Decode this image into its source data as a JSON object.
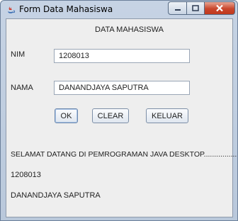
{
  "window": {
    "title": "Form Data Mahasiswa",
    "minimize_label": "minimize",
    "maximize_label": "maximize",
    "close_label": "close"
  },
  "form": {
    "heading": "DATA MAHASISWA",
    "nim_label": "NIM",
    "nim_value": "1208013",
    "nama_label": "NAMA",
    "nama_value": "DANANDJAYA SAPUTRA"
  },
  "buttons": {
    "ok": "OK",
    "clear": "CLEAR",
    "keluar": "KELUAR"
  },
  "output": {
    "welcome": "SELAMAT DATANG DI PEMROGRAMAN JAVA DESKTOP................",
    "nim": "1208013",
    "nama": "DANANDJAYA SAPUTRA"
  },
  "colors": {
    "titlebar": "#c6d3e4",
    "client_bg": "#eeeeee",
    "close_button": "#c9462c"
  }
}
